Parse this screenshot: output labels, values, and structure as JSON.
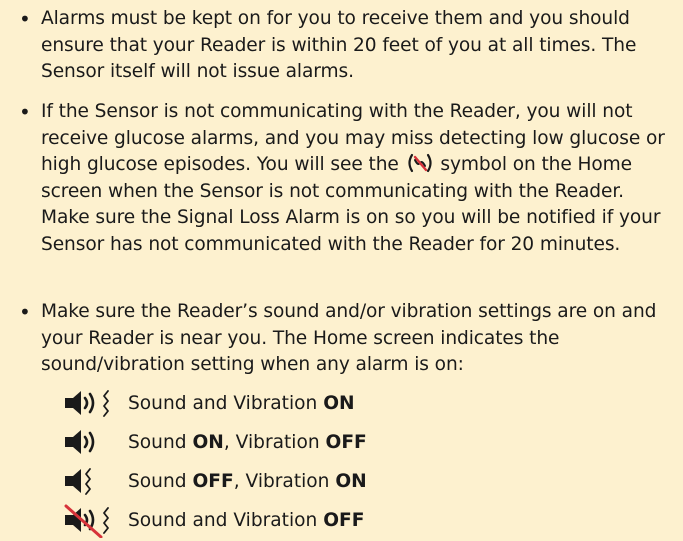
{
  "bullets": [
    {
      "text": "Alarms must be kept on for you to receive them and you should ensure that your Reader is within 20 feet of you at all times. The Sensor itself will not issue alarms."
    },
    {
      "text_before_icon": "If the Sensor is not communicating with the Reader, you will not receive glucose alarms, and you may miss detecting low glucose or high glucose episodes. You will see the",
      "icon": "signal-loss-icon",
      "text_after_icon": "symbol on the Home screen when the Sensor is not communicating with the Reader. Make sure the Signal Loss Alarm is on so you will be notified if your Sensor has not communicated with the Reader for 20 minutes."
    },
    {
      "text": "Make sure the Reader’s sound and/or vibration settings are on and your Reader is near you. The Home screen indicates the sound/vibration setting when any alarm is on:"
    }
  ],
  "settings": [
    {
      "icon": "sound-vibration-on-icon",
      "part1": "Sound and Vibration ",
      "state1": "ON",
      "part2": "",
      "state2": ""
    },
    {
      "icon": "sound-on-vibration-off-icon",
      "part1": "Sound ",
      "state1": "ON",
      "part2": ", Vibration ",
      "state2": "OFF"
    },
    {
      "icon": "sound-off-vibration-on-icon",
      "part1": "Sound ",
      "state1": "OFF",
      "part2": ", Vibration ",
      "state2": "ON"
    },
    {
      "icon": "sound-vibration-off-icon",
      "part1": "Sound and Vibration ",
      "state1": "OFF",
      "part2": "",
      "state2": ""
    }
  ],
  "colors": {
    "background": "#fdf1cf",
    "text": "#1a1a1a",
    "icon": "#1a1a1a",
    "slash_red": "#d6333a"
  }
}
